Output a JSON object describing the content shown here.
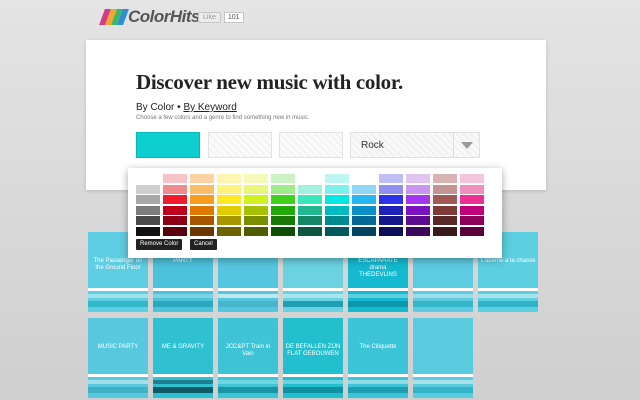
{
  "header": {
    "logo_text": "ColorHits",
    "logo_stripes": [
      "#d23a8a",
      "#f2a62a",
      "#3db56a",
      "#2e8fd6"
    ],
    "like_label": "Like",
    "like_count": "101"
  },
  "main": {
    "headline": "Discover new music with color.",
    "mode_color": "By Color",
    "mode_separator": "•",
    "mode_keyword": "By Keyword",
    "helper": "Choose a few colors and a genre to find something new in music.",
    "selected_color": "#0ecfd0",
    "genre_value": "Rock"
  },
  "picker": {
    "remove_label": "Remove Color",
    "cancel_label": "Cancel",
    "rows": [
      [
        "#ffffff",
        "#f7c3c8",
        "#fbd3a3",
        "#fdf5b0",
        "#f6f9b8",
        "#cdf3c4",
        "#ffffff",
        "#bdf6f3",
        "#ffffff",
        "#bfbff6",
        "#e1c4f2",
        "#d9b3b1",
        "#f5c5dc"
      ],
      [
        "#cfcfcf",
        "#ef8b8f",
        "#fbbd6a",
        "#fdf27a",
        "#e9f67c",
        "#9fec8a",
        "#a3f2e0",
        "#7cf0ea",
        "#8fd6f7",
        "#8f90f2",
        "#cb95f2",
        "#c39592",
        "#ef8fbe"
      ],
      [
        "#a7a7a7",
        "#f01c2c",
        "#fb9b1b",
        "#ffe924",
        "#cff21f",
        "#3fd21b",
        "#39e8b8",
        "#00e7e3",
        "#26b6f0",
        "#2d31ea",
        "#a337ef",
        "#a05955",
        "#ed2e93"
      ],
      [
        "#7c7c7c",
        "#c0001c",
        "#e07900",
        "#e3cd00",
        "#a5c200",
        "#24a90a",
        "#1fb88f",
        "#00bcc2",
        "#0c8ec8",
        "#1e22b8",
        "#7d12c2",
        "#7d3a37",
        "#c2007a"
      ],
      [
        "#4a4a4a",
        "#8a0014",
        "#a85500",
        "#a89600",
        "#7a8d00",
        "#197a07",
        "#158766",
        "#008a8e",
        "#066894",
        "#151889",
        "#5a0c8d",
        "#5a2927",
        "#8d0058"
      ],
      [
        "#111111",
        "#5a000c",
        "#6d3700",
        "#6d6100",
        "#4f5c00",
        "#0f4f04",
        "#0d5742",
        "#005a5d",
        "#034461",
        "#0d0f5a",
        "#3a075c",
        "#3a1a19",
        "#5c0039"
      ]
    ]
  },
  "albums": [
    {
      "text": "The Passenger on the Ground Floor",
      "bg": "#5fcde2",
      "bands": [
        "#ffffff",
        "#9ee2ea",
        "#2fb8c8"
      ]
    },
    {
      "text": "PARTY",
      "bg": "#4cc2dc",
      "bands": [
        "#ffffff",
        "#7fd4e4",
        "#2aa8c0"
      ]
    },
    {
      "text": "",
      "bg": "#55c6df",
      "bands": [
        "#ffffff",
        "#bfe9f0",
        "#48b5cc"
      ]
    },
    {
      "text": "",
      "bg": "#6ad2e0",
      "bands": [
        "#ffffff",
        "#a9e6ec",
        "#1f9fb4"
      ]
    },
    {
      "text": "ESCAPARATE drama THEDEVLINS",
      "bg": "#15b9d0",
      "bands": [
        "#ffffff",
        "#5fcfe0",
        "#0b98ae"
      ]
    },
    {
      "text": "",
      "bg": "#5dcbe0",
      "bands": [
        "#ffffff",
        "#9cdfea",
        "#34b6ca"
      ]
    },
    {
      "text": "L'abeme a la chasse",
      "bg": "#5ccfe0",
      "bands": [
        "#ffffff",
        "#a5e4ed",
        "#2fb3c6"
      ]
    },
    {
      "text": "MUSIC PARTY",
      "bg": "#58c8de",
      "bands": [
        "#ffffff",
        "#a3dfe9",
        "#3fb2c8"
      ]
    },
    {
      "text": "ME & GRAVITY",
      "bg": "#2fc0d2",
      "bands": [
        "#ffffff",
        "#1f7f8e",
        "#0e5b66"
      ]
    },
    {
      "text": "JCC&PT Train in Vain",
      "bg": "#3ec4d4",
      "bands": [
        "#ffffff",
        "#6fd6e2",
        "#1896a8"
      ]
    },
    {
      "text": "DE BEFALLEN ZIJN FLAT GEBOUWEN",
      "bg": "#22bfcf",
      "bands": [
        "#ffffff",
        "#69d3e0",
        "#118fa1"
      ]
    },
    {
      "text": "The Ciliquette",
      "bg": "#3cc5d8",
      "bands": [
        "#ffffff",
        "#8fdbe6",
        "#1e9db1"
      ]
    },
    {
      "text": "",
      "bg": "#5bcbe0",
      "bands": [
        "#ffffff",
        "#a8e2ec",
        "#34b4c9"
      ]
    }
  ]
}
